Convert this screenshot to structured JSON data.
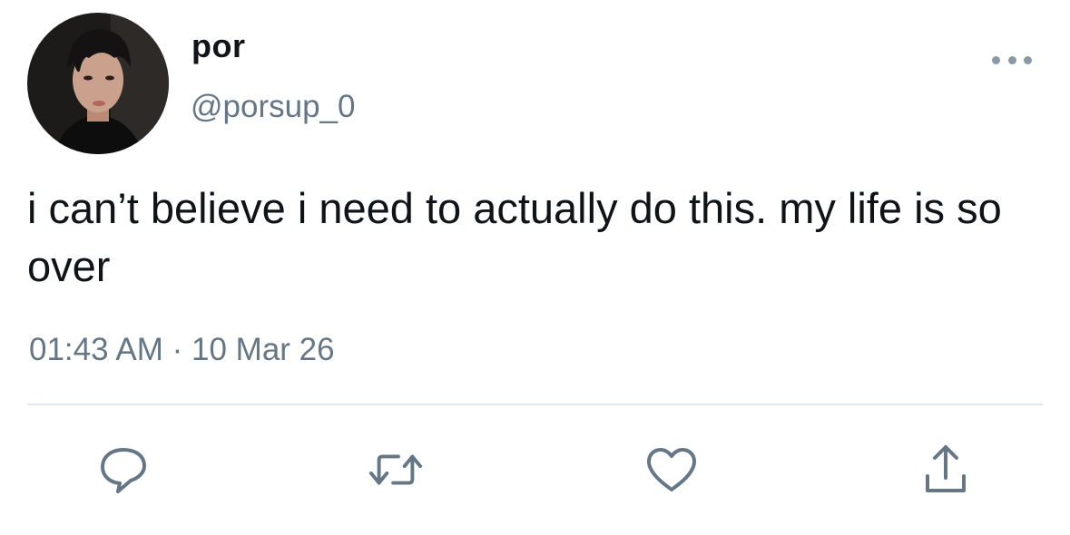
{
  "tweet": {
    "author": {
      "display_name": "por",
      "handle": "@porsup_0"
    },
    "text": "i can’t believe i need to actually do this. my life is so over",
    "time": "01:43 AM",
    "separator": "·",
    "date": "10 Mar 26"
  },
  "icons": {
    "more": "more-horizontal-icon",
    "reply": "reply-icon",
    "retweet": "retweet-icon",
    "like": "heart-icon",
    "share": "share-icon"
  },
  "colors": {
    "text_primary": "#0f1419",
    "text_secondary": "#657786",
    "icon": "#657786",
    "divider": "#e1e8ed"
  }
}
